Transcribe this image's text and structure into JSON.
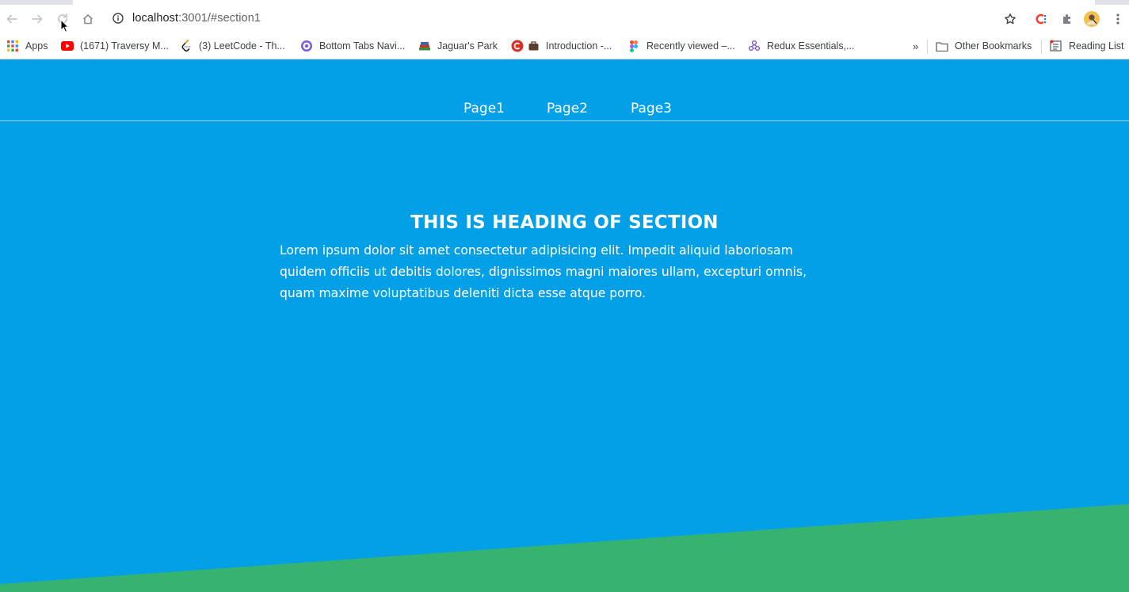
{
  "browser": {
    "url_host": "localhost",
    "url_path": ":3001/#section1",
    "bookmarks": [
      {
        "label": "Apps",
        "icon": "apps-grid-icon"
      },
      {
        "label": "(1671) Traversy M...",
        "icon": "youtube-icon"
      },
      {
        "label": "(3) LeetCode - Th...",
        "icon": "leetcode-icon"
      },
      {
        "label": "Bottom Tabs Navi...",
        "icon": "react-navigation-icon"
      },
      {
        "label": "Jaguar's Park",
        "icon": "books-icon"
      },
      {
        "label": "Introduction -...",
        "icon": "red-circle-icon"
      },
      {
        "label": "Recently viewed –...",
        "icon": "figma-icon"
      },
      {
        "label": "Redux Essentials,...",
        "icon": "redux-icon"
      }
    ],
    "overflow": "»",
    "other_bookmarks": "Other Bookmarks",
    "reading_list": "Reading List"
  },
  "nav": {
    "links": [
      "Page1",
      "Page2",
      "Page3"
    ]
  },
  "section": {
    "heading": "THIS IS HEADING OF SECTION",
    "paragraph": "Lorem ipsum dolor sit amet consectetur adipisicing elit. Impedit aliquid laboriosam quidem officiis ut debitis dolores, dignissimos magni maiores ullam, excepturi omnis, quam maxime voluptatibus deleniti dicta esse atque porro."
  },
  "colors": {
    "page_background": "#03a0e7",
    "wedge": "#36b46f"
  }
}
